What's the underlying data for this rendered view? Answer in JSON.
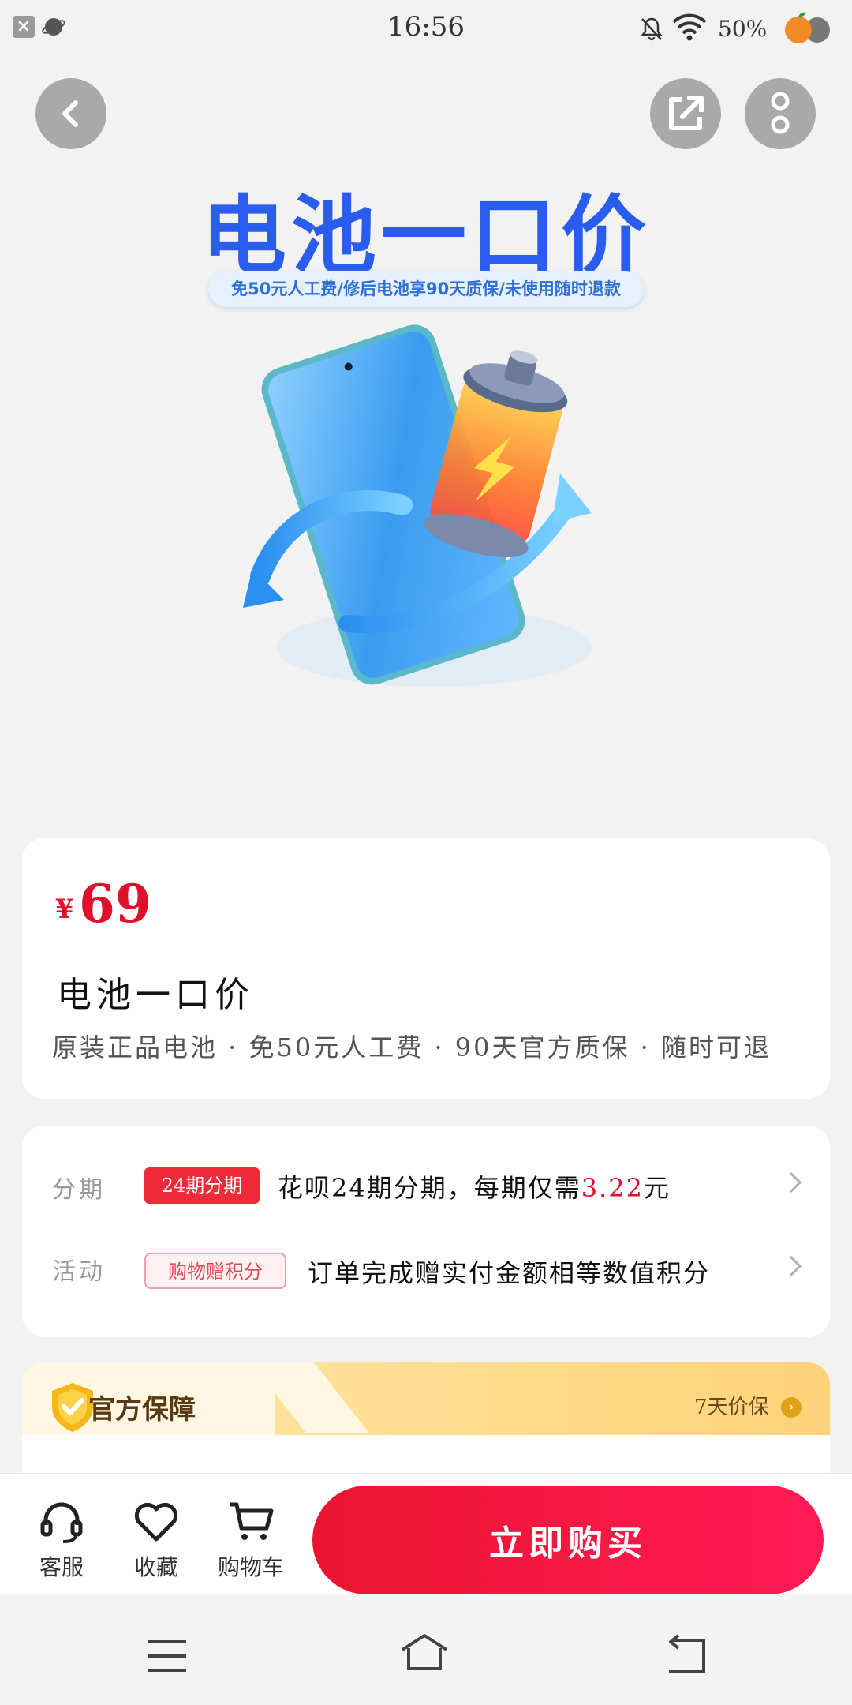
{
  "status_bar": {
    "time": "16:56",
    "battery": "50%",
    "icons": [
      "close-icon",
      "planet-icon",
      "bell-off-icon",
      "wifi-icon",
      "fruit-icon"
    ]
  },
  "top_actions": {
    "back": "back-arrow-icon",
    "share": "share-icon",
    "more": "more-vertical-icon"
  },
  "banner": {
    "title": "电池一口价",
    "subtitle": "免50元人工费/修后电池享90天质保/未使用随时退款"
  },
  "product": {
    "currency": "¥",
    "price": "69",
    "title": "电池一口价",
    "features": "原装正品电池 · 免50元人工费 · 90天官方质保 · 随时可退"
  },
  "promotions": [
    {
      "label": "分期",
      "tag": "24期分期",
      "text_before": "花呗24期分期，每期仅需",
      "highlight": "3.22",
      "text_after": "元"
    },
    {
      "label": "活动",
      "tag": "购物赠积分",
      "text": "订单完成赠实付金额相等数值积分"
    }
  ],
  "guarantee": {
    "title": "官方保障",
    "right_text": "7天价保"
  },
  "action_bar": {
    "service": "客服",
    "favorite": "收藏",
    "cart": "购物车",
    "buy": "立即购买"
  },
  "colors": {
    "brand_red": "#e0102a",
    "banner_blue": "#2a5cf0",
    "buy_gradient_start": "#ea1530",
    "buy_gradient_end": "#ff1a55"
  }
}
